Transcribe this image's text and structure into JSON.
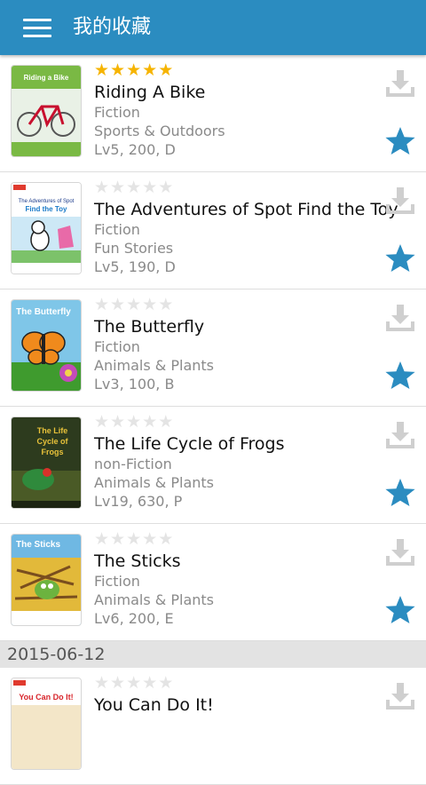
{
  "header": {
    "title": "我的收藏",
    "menu_icon": "menu-icon"
  },
  "colors": {
    "header_bg": "#2b8cc0",
    "star_rating": "#f6b400",
    "favorite_star": "#2b8cc0",
    "download_icon": "#cfcfcf"
  },
  "books": [
    {
      "title": "Riding A Bike",
      "genre": "Fiction",
      "category": "Sports & Outdoors",
      "level": "Lv5, 200, D",
      "rating": 5,
      "cover_text": "Riding a Bike",
      "favorited": true
    },
    {
      "title": "The Adventures of Spot Find the Toy",
      "genre": "Fiction",
      "category": "Fun Stories",
      "level": "Lv5, 190, D",
      "rating": 0,
      "cover_text": "The Adventures of Spot Find the Toy",
      "favorited": true
    },
    {
      "title": "The Butterfly",
      "genre": "Fiction",
      "category": "Animals & Plants",
      "level": "Lv3, 100, B",
      "rating": 0,
      "cover_text": "The Butterfly",
      "favorited": true
    },
    {
      "title": "The Life Cycle of Frogs",
      "genre": "non-Fiction",
      "category": "Animals & Plants",
      "level": "Lv19, 630, P",
      "rating": 0,
      "cover_text": "The Life Cycle of Frogs",
      "favorited": true
    },
    {
      "title": "The Sticks",
      "genre": "Fiction",
      "category": "Animals & Plants",
      "level": "Lv6, 200, E",
      "rating": 0,
      "cover_text": "The Sticks",
      "favorited": true
    }
  ],
  "date_separator": "2015-06-12",
  "books_after_date": [
    {
      "title": "You Can Do It!",
      "rating": 0,
      "cover_text": "You Can Do It!"
    }
  ]
}
